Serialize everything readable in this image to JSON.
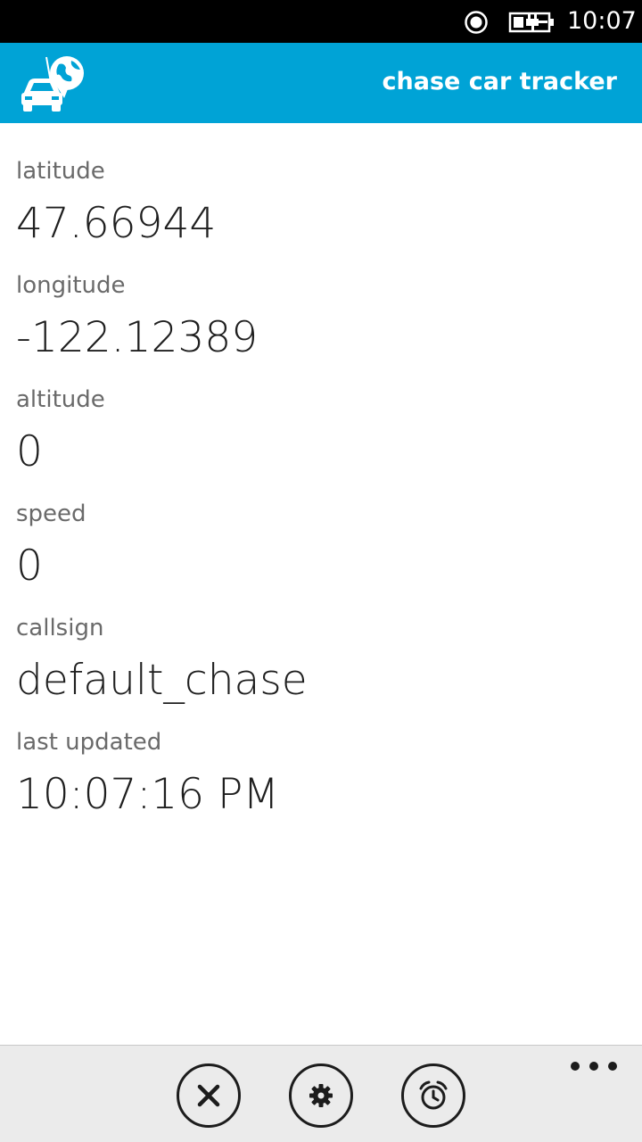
{
  "status_bar": {
    "time": "10:07",
    "icons": [
      "location-icon",
      "battery-charging-icon"
    ]
  },
  "header": {
    "title": "chase car tracker",
    "logo_icon": "car-globe-logo",
    "accent_color": "#00a3d6"
  },
  "fields": [
    {
      "label": "latitude",
      "value": "47.66944"
    },
    {
      "label": "longitude",
      "value": "-122.12389"
    },
    {
      "label": "altitude",
      "value": "0"
    },
    {
      "label": "speed",
      "value": "0"
    },
    {
      "label": "callsign",
      "value": "default_chase"
    },
    {
      "label": "last updated",
      "value": "10:07:16 PM"
    }
  ],
  "app_bar": {
    "buttons": [
      {
        "icon": "close-icon"
      },
      {
        "icon": "settings-icon"
      },
      {
        "icon": "alarm-clock-icon"
      }
    ],
    "more_icon": "more-dots-icon"
  }
}
